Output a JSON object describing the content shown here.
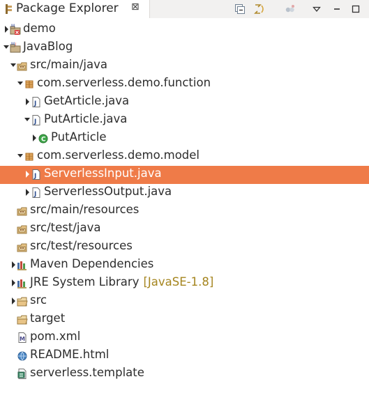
{
  "view": {
    "title": "Package Explorer",
    "close_glyph": "⊠",
    "toolbar": [
      "collapse-all-icon",
      "link-with-editor-icon",
      "filter-icon",
      "view-menu-icon",
      "minimize-icon",
      "maximize-icon"
    ]
  },
  "tree": [
    {
      "label": "demo",
      "icon": "maven-project-error-icon",
      "expanded": false,
      "depth": 0
    },
    {
      "label": "JavaBlog",
      "icon": "maven-project-icon",
      "expanded": true,
      "depth": 0
    },
    {
      "label": "src/main/java",
      "icon": "source-folder-icon",
      "expanded": true,
      "depth": 1
    },
    {
      "label": "com.serverless.demo.function",
      "icon": "package-icon",
      "expanded": true,
      "depth": 2
    },
    {
      "label": "GetArticle.java",
      "icon": "java-file-icon",
      "expanded": false,
      "depth": 3
    },
    {
      "label": "PutArticle.java",
      "icon": "java-file-icon",
      "expanded": true,
      "depth": 3
    },
    {
      "label": "PutArticle",
      "icon": "class-icon",
      "expanded": false,
      "depth": 4
    },
    {
      "label": "com.serverless.demo.model",
      "icon": "package-icon",
      "expanded": true,
      "depth": 2
    },
    {
      "label": "ServerlessInput.java",
      "icon": "java-file-icon",
      "expanded": false,
      "depth": 3,
      "selected": true
    },
    {
      "label": "ServerlessOutput.java",
      "icon": "java-file-icon",
      "expanded": false,
      "depth": 3
    },
    {
      "label": "src/main/resources",
      "icon": "source-folder-icon",
      "depth": 1
    },
    {
      "label": "src/test/java",
      "icon": "source-folder-icon",
      "depth": 1
    },
    {
      "label": "src/test/resources",
      "icon": "source-folder-icon",
      "depth": 1
    },
    {
      "label": "Maven Dependencies",
      "icon": "library-icon",
      "expanded": false,
      "depth": 1
    },
    {
      "label": "JRE System Library",
      "decoration": "[JavaSE-1.8]",
      "icon": "library-icon",
      "expanded": false,
      "depth": 1
    },
    {
      "label": "src",
      "icon": "folder-icon",
      "expanded": false,
      "depth": 1
    },
    {
      "label": "target",
      "icon": "folder-icon",
      "depth": 1
    },
    {
      "label": "pom.xml",
      "icon": "maven-pom-icon",
      "depth": 1
    },
    {
      "label": "README.html",
      "icon": "html-file-icon",
      "depth": 1
    },
    {
      "label": "serverless.template",
      "icon": "template-file-icon",
      "depth": 1
    }
  ],
  "colors": {
    "selection": "#ef7b48",
    "decoration": "#a5851f",
    "header_background": "#f2f1f0"
  }
}
